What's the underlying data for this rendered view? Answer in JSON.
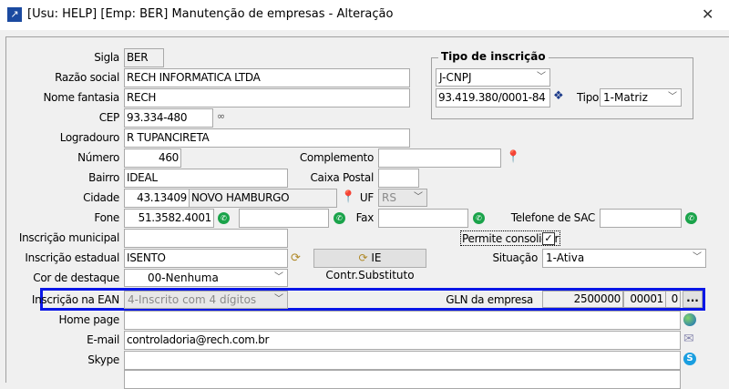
{
  "window": {
    "title": "[Usu: HELP] [Emp: BER] Manutenção de empresas - Alteração",
    "close": "✕"
  },
  "fields": {
    "sigla": {
      "label": "Sigla",
      "value": "BER"
    },
    "razao_social": {
      "label": "Razão social",
      "value": "RECH INFORMATICA LTDA"
    },
    "nome_fantasia": {
      "label": "Nome fantasia",
      "value": "RECH"
    },
    "cep": {
      "label": "CEP",
      "value": "93.334-480"
    },
    "logradouro": {
      "label": "Logradouro",
      "value": "R TUPANCIRETA"
    },
    "numero": {
      "label": "Número",
      "value": "460"
    },
    "complemento": {
      "label": "Complemento",
      "value": ""
    },
    "bairro": {
      "label": "Bairro",
      "value": "IDEAL"
    },
    "caixa_postal": {
      "label": "Caixa Postal",
      "value": ""
    },
    "cidade": {
      "label": "Cidade",
      "code": "43.13409",
      "name": "NOVO HAMBURGO"
    },
    "uf": {
      "label": "UF",
      "value": "RS"
    },
    "fone": {
      "label": "Fone",
      "value": "51.3582.4001",
      "value2": ""
    },
    "fax": {
      "label": "Fax",
      "value": ""
    },
    "telefone_sac": {
      "label": "Telefone de SAC",
      "value": ""
    },
    "inscricao_municipal": {
      "label": "Inscrição municipal",
      "value": ""
    },
    "permite_consolidar": {
      "label": "Permite consolidar",
      "checked": true
    },
    "inscricao_estadual": {
      "label": "Inscrição estadual",
      "value": "ISENTO"
    },
    "ie_button": "IE Contr.Substituto",
    "situacao": {
      "label": "Situação",
      "value": "1-Ativa"
    },
    "cor_destaque": {
      "label": "Cor de destaque",
      "value": "00-Nenhuma"
    },
    "inscricao_ean": {
      "label": "Inscrição na EAN",
      "value": "4-Inscrito com 4 dígitos"
    },
    "gln": {
      "label": "GLN da empresa",
      "part1": "2500000",
      "part2": "00001",
      "part3": "0",
      "button": "..."
    },
    "home_page": {
      "label": "Home page",
      "value": ""
    },
    "email": {
      "label": "E-mail",
      "value": "controladoria@rech.com.br"
    },
    "skype": {
      "label": "Skype",
      "value": ""
    }
  },
  "tipo_inscricao": {
    "legend": "Tipo de inscrição",
    "type": "J-CNPJ",
    "cnpj": "93.419.380/0001-84",
    "tipo_label": "Tipo",
    "tipo": "1-Matriz"
  },
  "colors": {
    "highlight": "#0a17e6",
    "whatsapp": "#1aa34a"
  }
}
